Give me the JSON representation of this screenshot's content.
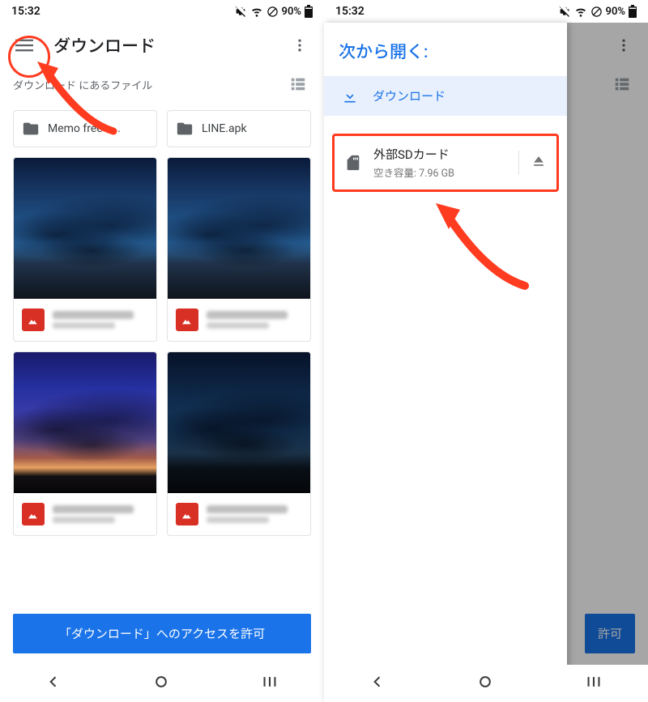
{
  "status": {
    "time": "15:32",
    "battery": "90%"
  },
  "left": {
    "title": "ダウンロード",
    "subheader": "ダウンロード にあるファイル",
    "folders": [
      {
        "name": "Memo free n..."
      },
      {
        "name": "LINE.apk"
      }
    ],
    "allow_button": "「ダウンロード」へのアクセスを許可"
  },
  "right": {
    "drawer_title": "次から開く:",
    "download_label": "ダウンロード",
    "sd": {
      "title": "外部SDカード",
      "subtitle": "空き容量: 7.96 GB"
    },
    "allow_button_peek": "許可"
  },
  "icons": {
    "hamburger": "hamburger-icon",
    "more": "more-vert-icon",
    "list": "list-view-icon",
    "folder": "folder-icon",
    "image": "image-icon",
    "download": "download-icon",
    "sdcard": "sdcard-icon",
    "eject": "eject-icon",
    "back": "back-icon",
    "home": "home-icon",
    "recents": "recents-icon",
    "mute": "mute-icon",
    "wifi": "wifi-icon",
    "nosim": "no-sim-icon",
    "battery": "battery-icon"
  }
}
